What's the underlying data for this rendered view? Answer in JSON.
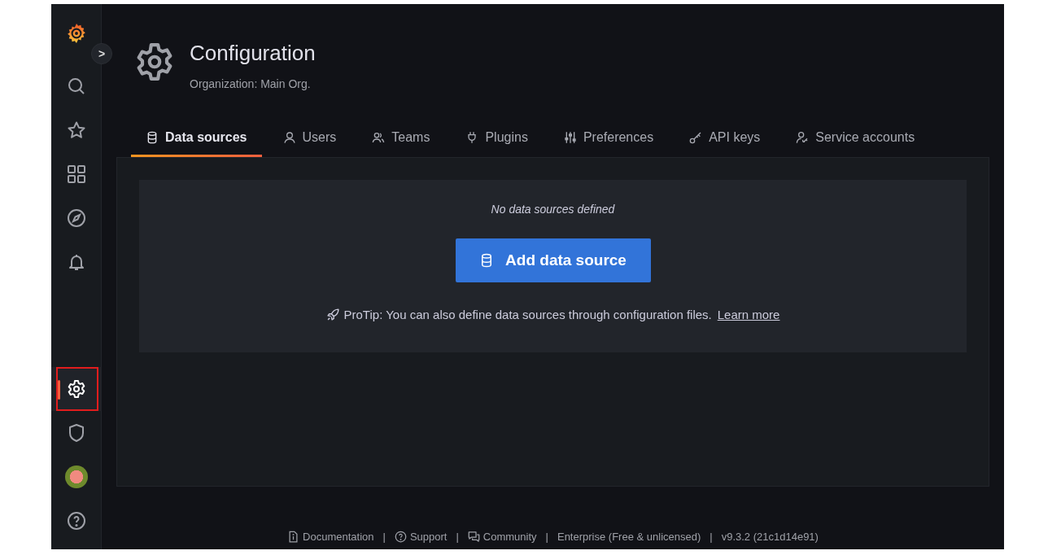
{
  "sidebar": {
    "top_items": [
      {
        "kind": "search",
        "selected": false
      },
      {
        "kind": "star",
        "selected": false
      },
      {
        "kind": "grid",
        "selected": false
      },
      {
        "kind": "compass",
        "selected": false
      },
      {
        "kind": "bell",
        "selected": false
      }
    ],
    "bottom_items": [
      {
        "kind": "gear",
        "selected": true,
        "highlighted": true
      },
      {
        "kind": "shield",
        "selected": false
      },
      {
        "kind": "avatar",
        "selected": false
      },
      {
        "kind": "help",
        "selected": false
      }
    ],
    "expand_button": ">"
  },
  "header": {
    "title": "Configuration",
    "subtitle": "Organization: Main Org."
  },
  "tabs": [
    {
      "label": "Data sources",
      "kind": "database",
      "selected": true
    },
    {
      "label": "Users",
      "kind": "user",
      "selected": false
    },
    {
      "label": "Teams",
      "kind": "users",
      "selected": false
    },
    {
      "label": "Plugins",
      "kind": "plug",
      "selected": false
    },
    {
      "label": "Preferences",
      "kind": "sliders",
      "selected": false
    },
    {
      "label": "API keys",
      "kind": "key",
      "selected": false
    },
    {
      "label": "Service accounts",
      "kind": "user-key",
      "selected": false
    }
  ],
  "empty_state": {
    "message": "No data sources defined",
    "button": "Add data source",
    "protip": "ProTip: You can also define data sources through configuration files.",
    "link": "Learn more"
  },
  "footer": [
    {
      "kind": "doc-link",
      "label": "Documentation"
    },
    {
      "kind": "separator",
      "label": "|"
    },
    {
      "kind": "help-link",
      "label": "Support"
    },
    {
      "kind": "separator",
      "label": "|"
    },
    {
      "kind": "chat-link",
      "label": "Community"
    },
    {
      "kind": "separator",
      "label": "|"
    },
    {
      "kind": "text",
      "label": "Enterprise (Free & unlicensed)"
    },
    {
      "kind": "separator",
      "label": "|"
    },
    {
      "kind": "text",
      "label": "v9.3.2 (21c1d14e91)"
    }
  ]
}
